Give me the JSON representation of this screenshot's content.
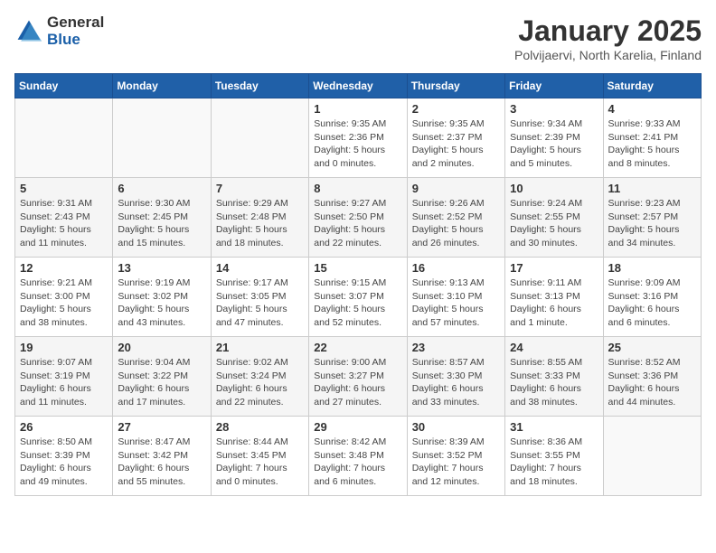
{
  "logo": {
    "general": "General",
    "blue": "Blue"
  },
  "title": "January 2025",
  "subtitle": "Polvijaervi, North Karelia, Finland",
  "headers": [
    "Sunday",
    "Monday",
    "Tuesday",
    "Wednesday",
    "Thursday",
    "Friday",
    "Saturday"
  ],
  "weeks": [
    [
      {
        "day": "",
        "info": ""
      },
      {
        "day": "",
        "info": ""
      },
      {
        "day": "",
        "info": ""
      },
      {
        "day": "1",
        "info": "Sunrise: 9:35 AM\nSunset: 2:36 PM\nDaylight: 5 hours\nand 0 minutes."
      },
      {
        "day": "2",
        "info": "Sunrise: 9:35 AM\nSunset: 2:37 PM\nDaylight: 5 hours\nand 2 minutes."
      },
      {
        "day": "3",
        "info": "Sunrise: 9:34 AM\nSunset: 2:39 PM\nDaylight: 5 hours\nand 5 minutes."
      },
      {
        "day": "4",
        "info": "Sunrise: 9:33 AM\nSunset: 2:41 PM\nDaylight: 5 hours\nand 8 minutes."
      }
    ],
    [
      {
        "day": "5",
        "info": "Sunrise: 9:31 AM\nSunset: 2:43 PM\nDaylight: 5 hours\nand 11 minutes."
      },
      {
        "day": "6",
        "info": "Sunrise: 9:30 AM\nSunset: 2:45 PM\nDaylight: 5 hours\nand 15 minutes."
      },
      {
        "day": "7",
        "info": "Sunrise: 9:29 AM\nSunset: 2:48 PM\nDaylight: 5 hours\nand 18 minutes."
      },
      {
        "day": "8",
        "info": "Sunrise: 9:27 AM\nSunset: 2:50 PM\nDaylight: 5 hours\nand 22 minutes."
      },
      {
        "day": "9",
        "info": "Sunrise: 9:26 AM\nSunset: 2:52 PM\nDaylight: 5 hours\nand 26 minutes."
      },
      {
        "day": "10",
        "info": "Sunrise: 9:24 AM\nSunset: 2:55 PM\nDaylight: 5 hours\nand 30 minutes."
      },
      {
        "day": "11",
        "info": "Sunrise: 9:23 AM\nSunset: 2:57 PM\nDaylight: 5 hours\nand 34 minutes."
      }
    ],
    [
      {
        "day": "12",
        "info": "Sunrise: 9:21 AM\nSunset: 3:00 PM\nDaylight: 5 hours\nand 38 minutes."
      },
      {
        "day": "13",
        "info": "Sunrise: 9:19 AM\nSunset: 3:02 PM\nDaylight: 5 hours\nand 43 minutes."
      },
      {
        "day": "14",
        "info": "Sunrise: 9:17 AM\nSunset: 3:05 PM\nDaylight: 5 hours\nand 47 minutes."
      },
      {
        "day": "15",
        "info": "Sunrise: 9:15 AM\nSunset: 3:07 PM\nDaylight: 5 hours\nand 52 minutes."
      },
      {
        "day": "16",
        "info": "Sunrise: 9:13 AM\nSunset: 3:10 PM\nDaylight: 5 hours\nand 57 minutes."
      },
      {
        "day": "17",
        "info": "Sunrise: 9:11 AM\nSunset: 3:13 PM\nDaylight: 6 hours\nand 1 minute."
      },
      {
        "day": "18",
        "info": "Sunrise: 9:09 AM\nSunset: 3:16 PM\nDaylight: 6 hours\nand 6 minutes."
      }
    ],
    [
      {
        "day": "19",
        "info": "Sunrise: 9:07 AM\nSunset: 3:19 PM\nDaylight: 6 hours\nand 11 minutes."
      },
      {
        "day": "20",
        "info": "Sunrise: 9:04 AM\nSunset: 3:22 PM\nDaylight: 6 hours\nand 17 minutes."
      },
      {
        "day": "21",
        "info": "Sunrise: 9:02 AM\nSunset: 3:24 PM\nDaylight: 6 hours\nand 22 minutes."
      },
      {
        "day": "22",
        "info": "Sunrise: 9:00 AM\nSunset: 3:27 PM\nDaylight: 6 hours\nand 27 minutes."
      },
      {
        "day": "23",
        "info": "Sunrise: 8:57 AM\nSunset: 3:30 PM\nDaylight: 6 hours\nand 33 minutes."
      },
      {
        "day": "24",
        "info": "Sunrise: 8:55 AM\nSunset: 3:33 PM\nDaylight: 6 hours\nand 38 minutes."
      },
      {
        "day": "25",
        "info": "Sunrise: 8:52 AM\nSunset: 3:36 PM\nDaylight: 6 hours\nand 44 minutes."
      }
    ],
    [
      {
        "day": "26",
        "info": "Sunrise: 8:50 AM\nSunset: 3:39 PM\nDaylight: 6 hours\nand 49 minutes."
      },
      {
        "day": "27",
        "info": "Sunrise: 8:47 AM\nSunset: 3:42 PM\nDaylight: 6 hours\nand 55 minutes."
      },
      {
        "day": "28",
        "info": "Sunrise: 8:44 AM\nSunset: 3:45 PM\nDaylight: 7 hours\nand 0 minutes."
      },
      {
        "day": "29",
        "info": "Sunrise: 8:42 AM\nSunset: 3:48 PM\nDaylight: 7 hours\nand 6 minutes."
      },
      {
        "day": "30",
        "info": "Sunrise: 8:39 AM\nSunset: 3:52 PM\nDaylight: 7 hours\nand 12 minutes."
      },
      {
        "day": "31",
        "info": "Sunrise: 8:36 AM\nSunset: 3:55 PM\nDaylight: 7 hours\nand 18 minutes."
      },
      {
        "day": "",
        "info": ""
      }
    ]
  ]
}
